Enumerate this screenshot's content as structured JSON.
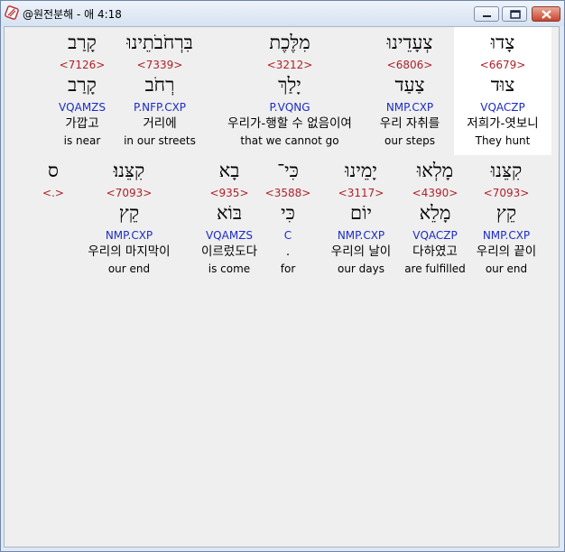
{
  "window": {
    "title": "@원전분해 - 애 4:18",
    "icon": "app-icon",
    "controls": [
      "minimize-icon",
      "maximize-icon",
      "close-icon"
    ]
  },
  "colors": {
    "strong": "#b0202a",
    "parse": "#1d2cc4",
    "selected_background": "#ffffff",
    "panel_background": "#efefef"
  },
  "rows": [
    {
      "words": [
        {
          "heb": "צָדוּ",
          "strong": "<6679>",
          "lemma": "צוּד",
          "parse": "VQACZP",
          "ko": "저희가-엿보니",
          "en": "They hunt",
          "selected": true
        },
        {
          "heb": "צְעָדֵינוּ",
          "strong": "<6806>",
          "lemma": "צַעַד",
          "parse": "NMP.CXP",
          "ko": "우리 자취를",
          "en": "our steps"
        },
        {
          "heb": "מִלֶּכֶת",
          "strong": "<3212>",
          "lemma": "יָלַךְ",
          "parse": "P.VQNG",
          "ko": "우리가-행할 수 없음이여",
          "en": "that we cannot go"
        },
        {
          "heb": "בִּרְחֹבֹתֵינוּ",
          "strong": "<7339>",
          "lemma": "רְחֹב",
          "parse": "P.NFP.CXP",
          "ko": "거리에",
          "en": "in our streets"
        },
        {
          "heb": "קָרַב",
          "strong": "<7126>",
          "lemma": "קָרַב",
          "parse": "VQAMZS",
          "ko": "가깝고",
          "en": "is near"
        }
      ]
    },
    {
      "words": [
        {
          "heb": "קִצֵּנוּ",
          "strong": "<7093>",
          "lemma": "קֵץ",
          "parse": "NMP.CXP",
          "ko": "우리의 끝이",
          "en": "our end"
        },
        {
          "heb": "מָלְאוּ",
          "strong": "<4390>",
          "lemma": "מָלֵא",
          "parse": "VQACZP",
          "ko": "다하였고",
          "en": "are fulfilled"
        },
        {
          "heb": "יָמֵינוּ",
          "strong": "<3117>",
          "lemma": "יוֹם",
          "parse": "NMP.CXP",
          "ko": "우리의 날이",
          "en": "our days"
        },
        {
          "heb": "כִּי־",
          "strong": "<3588>",
          "lemma": "כִּי",
          "parse": "C",
          "ko": ".",
          "en": "for"
        },
        {
          "heb": "בָא",
          "strong": "<935>",
          "lemma": "בּוֹא",
          "parse": "VQAMZS",
          "ko": "이르렀도다",
          "en": "is come"
        },
        {
          "heb": "קִצֵּנוּ׃",
          "strong": "<7093>",
          "lemma": "קֵץ",
          "parse": "NMP.CXP",
          "ko": "우리의 마지막이",
          "en": "our end"
        },
        {
          "heb": "ס",
          "strong": "<.>",
          "lemma": "",
          "parse": "",
          "ko": "",
          "en": ""
        }
      ]
    }
  ]
}
